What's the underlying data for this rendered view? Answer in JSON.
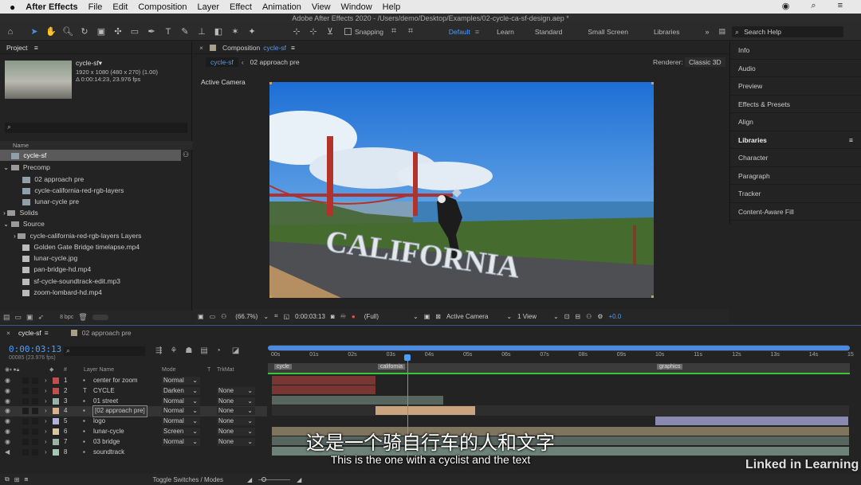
{
  "menubar": {
    "apple": "",
    "app": "After Effects",
    "items": [
      "File",
      "Edit",
      "Composition",
      "Layer",
      "Effect",
      "Animation",
      "View",
      "Window",
      "Help"
    ]
  },
  "window_title": "Adobe After Effects 2020 - /Users/demo/Desktop/Examples/02-cycle-ca-sf-design.aep *",
  "toolbar": {
    "snapping": "Snapping",
    "workspaces": [
      "Default",
      "Learn",
      "Standard",
      "Small Screen",
      "Libraries"
    ],
    "search_help": "Search Help"
  },
  "project": {
    "title": "Project",
    "comp_name": "cycle-sf▾",
    "comp_info1": "1920 x 1080  (480 x 270) (1.00)",
    "comp_info2": "Δ 0:00:14:23, 23.976 fps",
    "col_name": "Name",
    "items": [
      "cycle-sf",
      "Precomp",
      "02 approach pre",
      "cycle-california-red-rgb-layers",
      "lunar-cycle pre",
      "Solids",
      "Source",
      "cycle-california-red-rgb-layers Layers",
      "Golden Gate Bridge timelapse.mp4",
      "lunar-cycle.jpg",
      "pan-bridge-hd.mp4",
      "sf-cycle-soundtrack-edit.mp3",
      "zoom-lombard-hd.mp4"
    ],
    "bpc": "8 bpc"
  },
  "composition": {
    "tab_prefix": "Composition",
    "tab_name": "cycle-sf",
    "crumbs": [
      "cycle-sf",
      "02 approach pre"
    ],
    "renderer_label": "Renderer:",
    "renderer": "Classic 3D",
    "view_label": "Active Camera",
    "footer": {
      "zoom": "(66.7%)",
      "timecode": "0:00:03:13",
      "resolution": "(Full)",
      "camera": "Active Camera",
      "view": "1 View",
      "exposure": "+0.0"
    }
  },
  "right_panels": [
    "Info",
    "Audio",
    "Preview",
    "Effects & Presets",
    "Align",
    "Libraries",
    "Character",
    "Paragraph",
    "Tracker",
    "Content-Aware Fill"
  ],
  "timeline": {
    "tabs": [
      "cycle-sf",
      "02 approach pre"
    ],
    "timecode": "0:00:03:13",
    "frames": "00085 (23.976 fps)",
    "col_layer": "Layer Name",
    "col_mode": "Mode",
    "col_t": "T",
    "col_trkmat": "TrkMat",
    "ruler": [
      "00s",
      "01s",
      "02s",
      "03s",
      "04s",
      "05s",
      "06s",
      "07s",
      "08s",
      "09s",
      "10s",
      "11s",
      "12s",
      "13s",
      "14s",
      "15"
    ],
    "markers": [
      "cycle",
      "california",
      "graphics"
    ],
    "layers": [
      {
        "num": "1",
        "name": "center for zoom",
        "mode": "Normal",
        "trk": "",
        "color": "#c0504d"
      },
      {
        "num": "2",
        "name": "CYCLE",
        "mode": "Darken",
        "trk": "None",
        "color": "#c0504d"
      },
      {
        "num": "3",
        "name": "01 street",
        "mode": "Normal",
        "trk": "None",
        "color": "#9ab3a8"
      },
      {
        "num": "4",
        "name": "[02 approach pre]",
        "mode": "Normal",
        "trk": "None",
        "color": "#d9b38c"
      },
      {
        "num": "5",
        "name": "logo",
        "mode": "Normal",
        "trk": "None",
        "color": "#b3b3d9"
      },
      {
        "num": "6",
        "name": "lunar-cycle",
        "mode": "Screen",
        "trk": "None",
        "color": "#d9c7a0"
      },
      {
        "num": "7",
        "name": "03 bridge",
        "mode": "Normal",
        "trk": "None",
        "color": "#9ab3a8"
      },
      {
        "num": "8",
        "name": "soundtrack",
        "mode": "",
        "trk": "",
        "color": "#a6c7b8"
      }
    ],
    "toggle": "Toggle Switches / Modes"
  },
  "subtitles": {
    "zh": "这是一个骑自行车的人和文字",
    "en": "This is the one with a cyclist and the text"
  },
  "watermark": "Linked in Learning"
}
